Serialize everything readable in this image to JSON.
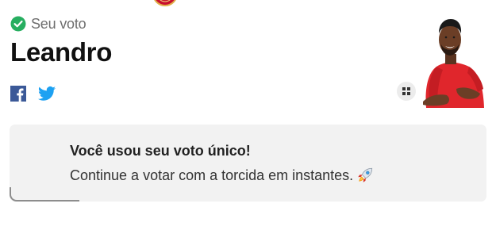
{
  "vote": {
    "status_label": "Seu voto",
    "candidate_name": "Leandro"
  },
  "share": {
    "facebook_icon": "facebook-icon",
    "twitter_icon": "twitter-icon"
  },
  "actions": {
    "grid_icon": "grid-icon"
  },
  "notice": {
    "title": "Você usou seu voto único!",
    "message": "Continue a votar com a torcida em instantes.",
    "emoji_icon": "rocket-icon"
  },
  "colors": {
    "check_green": "#27ae60",
    "facebook_blue": "#3b5998",
    "twitter_blue": "#1da1f2",
    "shirt_red": "#e0262c",
    "card_background": "#f2f2f2"
  }
}
